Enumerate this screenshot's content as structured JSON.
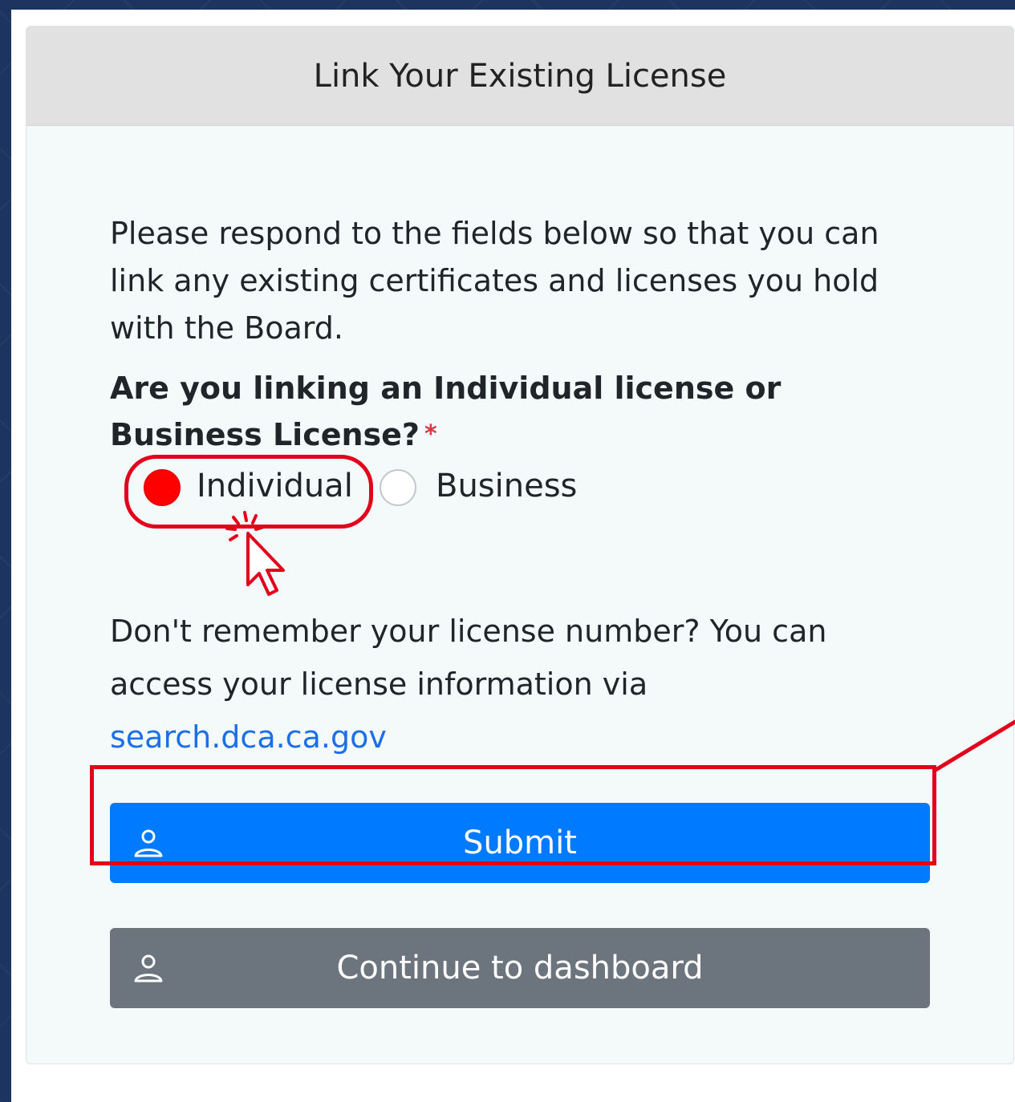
{
  "card": {
    "title": "Link Your Existing License"
  },
  "form": {
    "intro": "Please respond to the fields below so that you can link any existing certificates and licenses you hold with the Board.",
    "question": "Are you linking an Individual license or Business License?",
    "required_marker": "*",
    "options": [
      {
        "label": "Individual",
        "selected": true
      },
      {
        "label": "Business",
        "selected": false
      }
    ],
    "help_text": "Don't remember your license number? You can access your license information via",
    "help_link": "search.dca.ca.gov"
  },
  "buttons": {
    "submit": {
      "label": "Submit",
      "icon": "user-icon"
    },
    "dashboard": {
      "label": "Continue to dashboard",
      "icon": "user-icon"
    }
  },
  "colors": {
    "accent_red": "#e3001b",
    "primary": "#007bff",
    "secondary": "#6c757d",
    "link": "#1c6fe8"
  }
}
